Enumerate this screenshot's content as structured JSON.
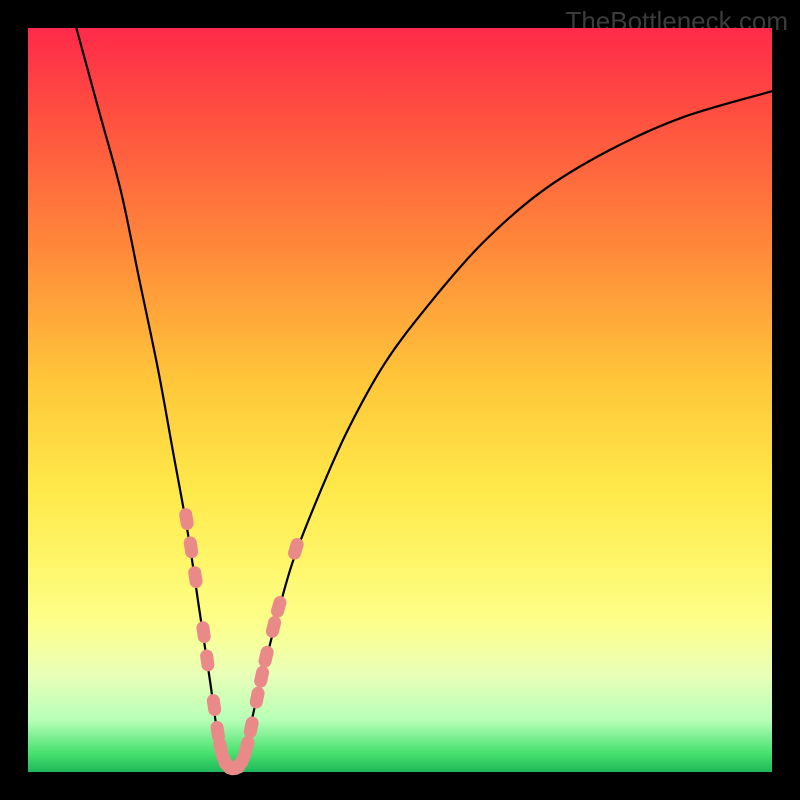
{
  "watermark": "TheBottleneck.com",
  "chart_data": {
    "type": "line",
    "title": "",
    "xlabel": "",
    "ylabel": "",
    "xlim": [
      0,
      100
    ],
    "ylim": [
      0,
      100
    ],
    "background": "rainbow-vertical",
    "curve": {
      "description": "V-shaped bottleneck curve; sharp minimum near x≈26, rises steeply on both sides",
      "points": [
        {
          "x": 6.5,
          "y": 100
        },
        {
          "x": 9.5,
          "y": 89
        },
        {
          "x": 12.5,
          "y": 78
        },
        {
          "x": 15.0,
          "y": 66
        },
        {
          "x": 17.5,
          "y": 54
        },
        {
          "x": 19.5,
          "y": 43
        },
        {
          "x": 21.5,
          "y": 32
        },
        {
          "x": 23.0,
          "y": 22
        },
        {
          "x": 24.5,
          "y": 12
        },
        {
          "x": 25.5,
          "y": 5
        },
        {
          "x": 26.5,
          "y": 1
        },
        {
          "x": 27.5,
          "y": 0.5
        },
        {
          "x": 28.5,
          "y": 1
        },
        {
          "x": 29.5,
          "y": 4.5
        },
        {
          "x": 31.0,
          "y": 11
        },
        {
          "x": 33.0,
          "y": 19
        },
        {
          "x": 35.5,
          "y": 28
        },
        {
          "x": 39.0,
          "y": 37
        },
        {
          "x": 43.0,
          "y": 46
        },
        {
          "x": 48.0,
          "y": 55
        },
        {
          "x": 54.0,
          "y": 63
        },
        {
          "x": 61.0,
          "y": 71
        },
        {
          "x": 69.0,
          "y": 78
        },
        {
          "x": 78.0,
          "y": 83.5
        },
        {
          "x": 88.0,
          "y": 88
        },
        {
          "x": 100.0,
          "y": 91.5
        }
      ]
    },
    "highlight_points": {
      "description": "Salmon lozenge markers clustered near the curve's minimum",
      "color": "#e98a88",
      "points": [
        {
          "x": 21.3,
          "y": 34.0
        },
        {
          "x": 21.9,
          "y": 30.2
        },
        {
          "x": 22.5,
          "y": 26.2
        },
        {
          "x": 23.6,
          "y": 18.8
        },
        {
          "x": 24.1,
          "y": 15.0
        },
        {
          "x": 25.0,
          "y": 9.0
        },
        {
          "x": 25.5,
          "y": 5.4
        },
        {
          "x": 25.9,
          "y": 3.2
        },
        {
          "x": 26.4,
          "y": 1.6
        },
        {
          "x": 27.0,
          "y": 0.8
        },
        {
          "x": 27.7,
          "y": 0.6
        },
        {
          "x": 28.3,
          "y": 0.9
        },
        {
          "x": 28.9,
          "y": 1.8
        },
        {
          "x": 29.4,
          "y": 3.4
        },
        {
          "x": 30.0,
          "y": 6.0
        },
        {
          "x": 30.8,
          "y": 10.0
        },
        {
          "x": 31.4,
          "y": 12.8
        },
        {
          "x": 32.0,
          "y": 15.5
        },
        {
          "x": 33.0,
          "y": 19.5
        },
        {
          "x": 33.7,
          "y": 22.2
        },
        {
          "x": 36.0,
          "y": 30.0
        }
      ]
    }
  }
}
